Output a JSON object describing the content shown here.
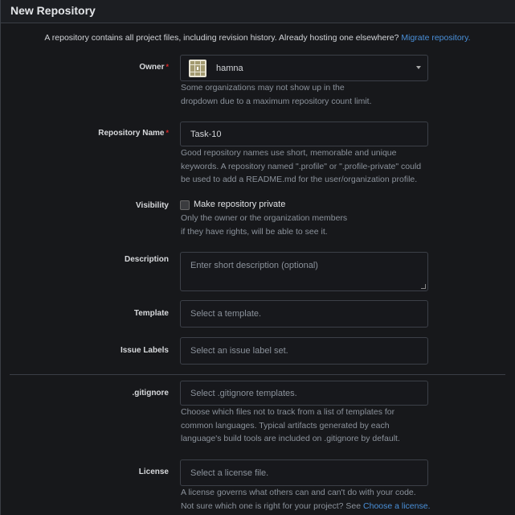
{
  "header": {
    "title": "New Repository"
  },
  "intro": {
    "text": "A repository contains all project files, including revision history. Already hosting one elsewhere? ",
    "link": "Migrate repository."
  },
  "owner": {
    "label": "Owner",
    "required": "*",
    "value": "hamna",
    "help": [
      "Some organizations may not show up in the",
      "dropdown due to a maximum repository count limit."
    ]
  },
  "repo_name": {
    "label": "Repository Name",
    "required": "*",
    "value": "Task-10",
    "help": [
      "Good repository names use short, memorable and unique",
      "keywords. A repository named \".profile\" or \".profile-private\" could",
      "be used to add a README.md for the user/organization profile."
    ]
  },
  "visibility": {
    "label": "Visibility",
    "checkbox_label": "Make repository private",
    "checked": false,
    "help": [
      "Only the owner or the organization members",
      "if they have rights, will be able to see it."
    ]
  },
  "description": {
    "label": "Description",
    "placeholder": "Enter short description (optional)"
  },
  "template": {
    "label": "Template",
    "placeholder": "Select a template."
  },
  "issue_labels": {
    "label": "Issue Labels",
    "placeholder": "Select an issue label set."
  },
  "gitignore": {
    "label": ".gitignore",
    "placeholder": "Select .gitignore templates.",
    "help": [
      "Choose which files not to track from a list of templates for",
      "common languages. Typical artifacts generated by each",
      "language's build tools are included on .gitignore by default."
    ]
  },
  "license": {
    "label": "License",
    "placeholder": "Select a license file.",
    "help": [
      "A license governs what others can and can't do with your code.",
      "Not sure which one is right for your project? See "
    ],
    "help_link": "Choose a license."
  }
}
